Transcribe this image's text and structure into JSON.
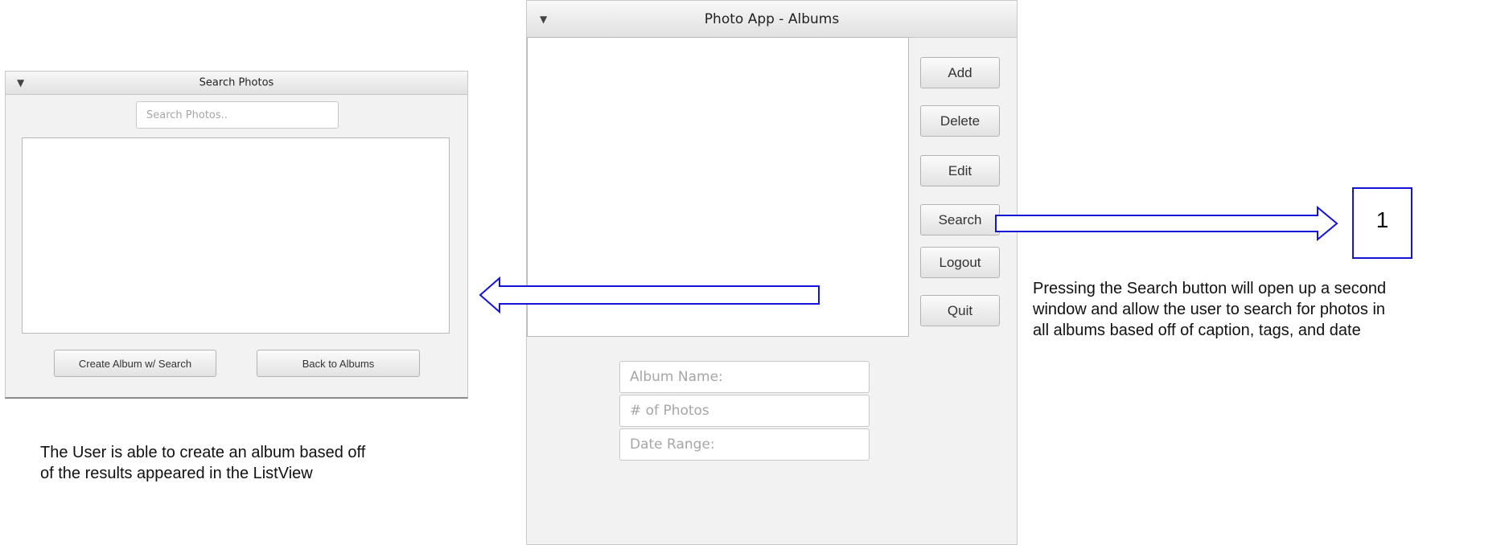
{
  "search_window": {
    "title": "Search Photos",
    "search_placeholder": "Search Photos..",
    "create_album_label": "Create Album w/ Search",
    "back_to_albums_label": "Back to Albums"
  },
  "albums_window": {
    "title": "Photo App - Albums",
    "buttons": {
      "add": "Add",
      "delete": "Delete",
      "edit": "Edit",
      "search": "Search",
      "logout": "Logout",
      "quit": "Quit"
    },
    "album_name_placeholder": "Album Name:",
    "photo_count_placeholder": "# of Photos",
    "date_range_placeholder": "Date Range:"
  },
  "annotations": {
    "step_number": "1",
    "search_note": [
      "Pressing the Search button will open up a second",
      "window and allow the user to search for photos in",
      "all albums based off of caption, tags, and date"
    ],
    "listview_note": [
      "The User is able to create an album based off",
      "of the results appeared in the ListView"
    ]
  },
  "icons": {
    "menu": "triangle-down-icon",
    "arrow_right": "arrow-right-icon",
    "arrow_left": "arrow-left-icon"
  },
  "colors": {
    "annotation_blue": "#1414d9",
    "window_bg": "#f2f2f2"
  }
}
